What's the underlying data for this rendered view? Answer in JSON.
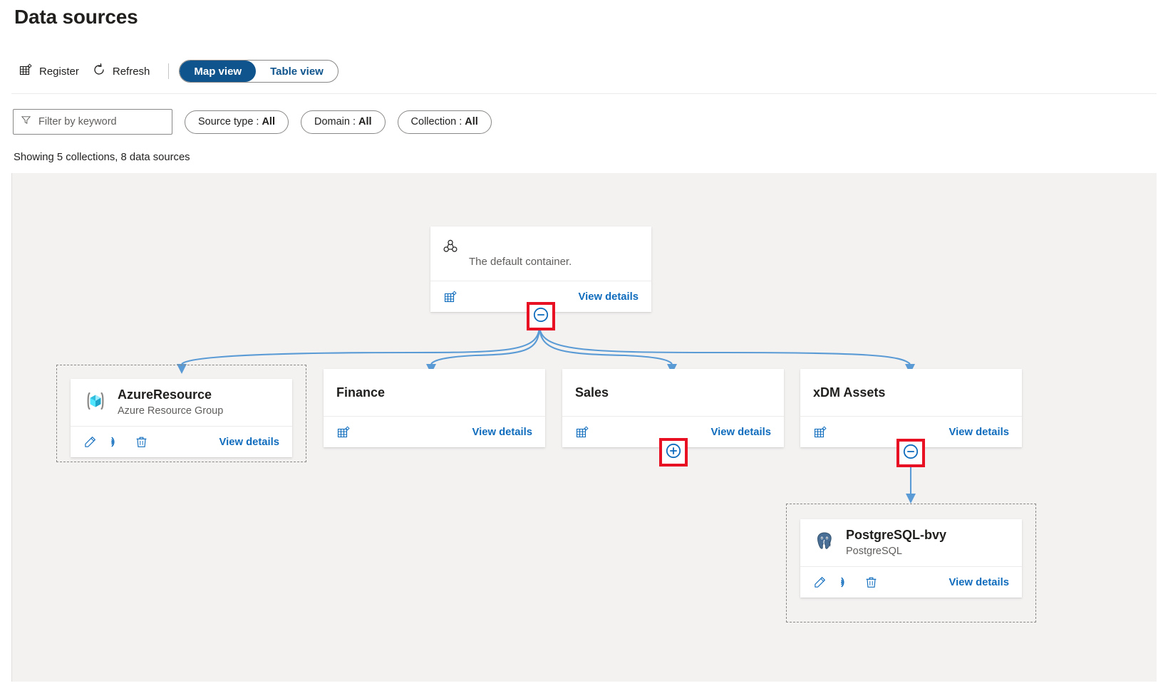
{
  "header": {
    "title": "Data sources",
    "register_label": "Register",
    "refresh_label": "Refresh",
    "register_icon": "register-table-icon",
    "refresh_icon": "refresh-circular-arrow-icon"
  },
  "views": {
    "map_label": "Map view",
    "table_label": "Table view",
    "active": "Map view"
  },
  "filters": {
    "search_placeholder": "Filter by keyword",
    "search_value": "",
    "search_icon": "filter-funnel-icon",
    "chips": [
      {
        "label": "Source type :",
        "value": "All"
      },
      {
        "label": "Domain :",
        "value": "All"
      },
      {
        "label": "Collection :",
        "value": "All"
      }
    ]
  },
  "status": {
    "showing": "Showing 5 collections, 8 data sources"
  },
  "colors": {
    "accent_blue": "#0f6cbd",
    "pivot_blue": "#0f548c",
    "highlight_red": "#e81123",
    "edge_blue": "#5b9bd5",
    "canvas_bg": "#f3f2f1"
  },
  "map": {
    "root": {
      "name": "root-collection-card",
      "icon": "collection-group-icon",
      "description": "The default container.",
      "footer_icon": "register-table-icon",
      "view_details": "View details",
      "toggle": {
        "state": "collapse",
        "glyph": "minus",
        "highlighted": true
      }
    },
    "children": [
      {
        "name": "azure-resource-source-card",
        "title": "AzureResource",
        "subtitle": "Azure Resource Group",
        "icon": "azure-resource-group-icon",
        "selected": true,
        "view_details": "View details",
        "actions": [
          "edit-pencil-icon",
          "scan-radar-icon",
          "delete-trash-icon"
        ],
        "toggle": null
      },
      {
        "name": "finance-collection-card",
        "title": "Finance",
        "subtitle": "",
        "icon": "",
        "selected": false,
        "view_details": "View details",
        "footer_icon": "register-table-icon",
        "toggle": null
      },
      {
        "name": "sales-collection-card",
        "title": "Sales",
        "subtitle": "",
        "icon": "",
        "selected": false,
        "view_details": "View details",
        "footer_icon": "register-table-icon",
        "toggle": {
          "state": "expand",
          "glyph": "plus",
          "highlighted": true
        }
      },
      {
        "name": "xdm-assets-collection-card",
        "title": "xDM Assets",
        "subtitle": "",
        "icon": "",
        "selected": false,
        "view_details": "View details",
        "footer_icon": "register-table-icon",
        "toggle": {
          "state": "collapse",
          "glyph": "minus",
          "highlighted": true
        }
      }
    ],
    "grandchild": {
      "name": "postgresql-source-card",
      "title": "PostgreSQL-bvy",
      "subtitle": "PostgreSQL",
      "icon": "postgresql-elephant-icon",
      "selected": true,
      "view_details": "View details",
      "actions": [
        "edit-pencil-icon",
        "scan-radar-icon",
        "delete-trash-icon"
      ]
    }
  }
}
